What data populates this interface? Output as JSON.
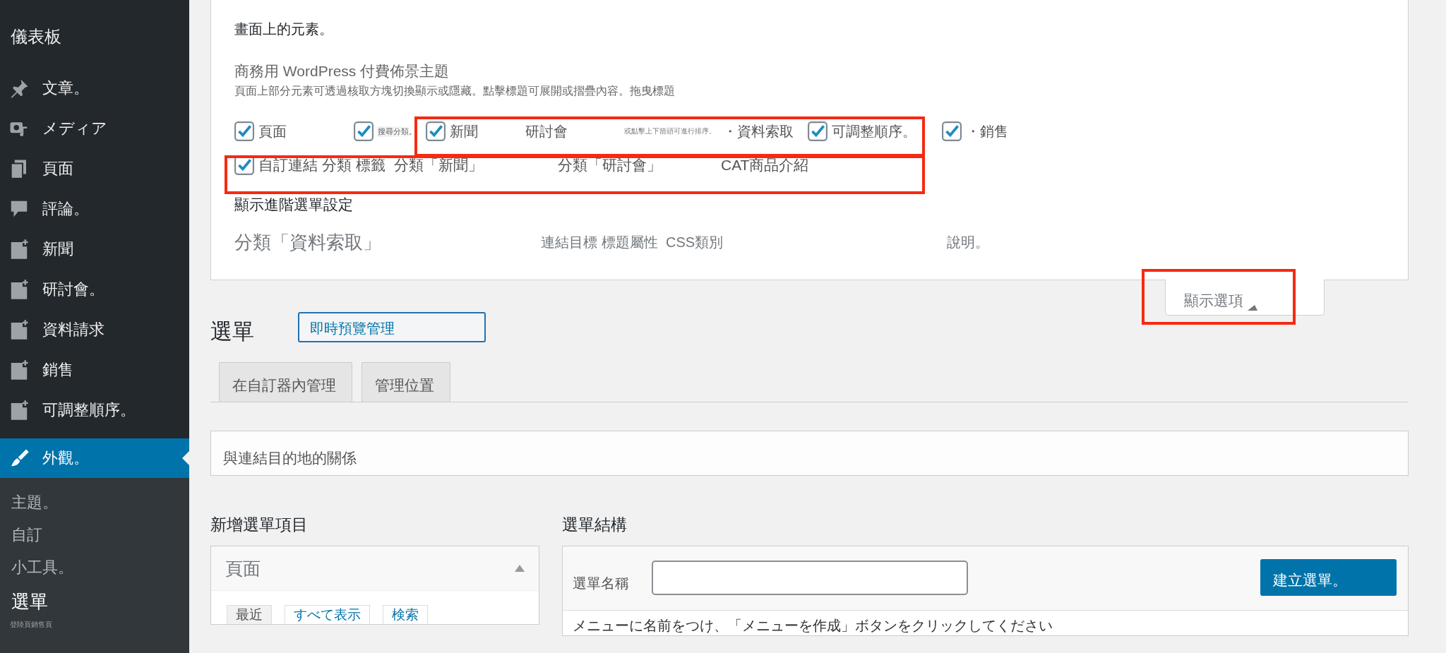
{
  "sidebar": {
    "title": "儀表板",
    "items": [
      {
        "label": "文章。",
        "selected": false
      },
      {
        "label": "メディア",
        "selected": false
      },
      {
        "label": "頁面",
        "selected": false
      },
      {
        "label": "評論。",
        "selected": false
      },
      {
        "label": "新聞",
        "selected": false
      },
      {
        "label": "研討會。",
        "selected": false
      },
      {
        "label": "資料請求",
        "selected": false
      },
      {
        "label": "銷售",
        "selected": false
      },
      {
        "label": "可調整順序。",
        "selected": false
      },
      {
        "label": "外觀。",
        "selected": true
      }
    ],
    "submenu": [
      {
        "label": "主題。",
        "selected": false
      },
      {
        "label": "自訂",
        "selected": false
      },
      {
        "label": "小工具。",
        "selected": false
      },
      {
        "label": "選單",
        "selected": true
      }
    ],
    "footnote": "登陸頁銷售頁"
  },
  "screen_options": {
    "intro": "畫面上的元素。",
    "title": "商務用 WordPress 付費佈景主題",
    "hint": "頁面上部分元素可透過核取方塊切換顯示或隱藏。點擊標題可展開或摺疊內容。拖曳標題",
    "row_1": [
      {
        "kind": "checkbox",
        "label": "頁面",
        "checked": true
      },
      {
        "kind": "checkbox",
        "label": "搜尋分類。",
        "checked": true
      },
      {
        "kind": "checkbox",
        "label": "新聞",
        "checked": true
      },
      {
        "kind": "text",
        "label": "研討會"
      },
      {
        "kind": "note",
        "label": "或點擊上下箭頭可進行排序。"
      },
      {
        "kind": "text",
        "label": "・資料索取"
      },
      {
        "kind": "checkbox",
        "label": "可調整順序。",
        "checked": true
      },
      {
        "kind": "checkbox",
        "label": "・銷售",
        "checked": true
      }
    ],
    "row_2": [
      {
        "kind": "checkbox",
        "label": "自訂連結 分類 標籤",
        "checked": true
      },
      {
        "kind": "text",
        "label": "分類「新聞」"
      },
      {
        "kind": "text",
        "label": "分類「研討會」"
      },
      {
        "kind": "text",
        "label": "CAT商品介紹"
      }
    ],
    "advanced_title": "顯示進階選單設定",
    "advanced": [
      "分類「資料索取」",
      "連結目標 標題屬性",
      "CSS類別",
      "說明。"
    ],
    "toggle": "顯示選項"
  },
  "page": {
    "title": "選單",
    "preview_button": "即時預覽管理",
    "tabs": [
      {
        "label": "在自訂器內管理",
        "selected": false
      },
      {
        "label": "管理位置",
        "selected": false
      }
    ],
    "relation_box": "與連結目的地的關係",
    "add_items_title": "新增選單項目",
    "structure_title": "選單結構",
    "panel": {
      "title": "頁面",
      "expanded": true,
      "tabs": [
        {
          "label": "最近",
          "selected": true
        },
        {
          "label": "すべて表示",
          "selected": false
        },
        {
          "label": "検索",
          "selected": false
        }
      ]
    },
    "menu_name_label": "選單名稱",
    "create_button": "建立選單。",
    "instructions": "メニューに名前をつけ、「メニューを作成」ボタンをクリックしてください"
  }
}
